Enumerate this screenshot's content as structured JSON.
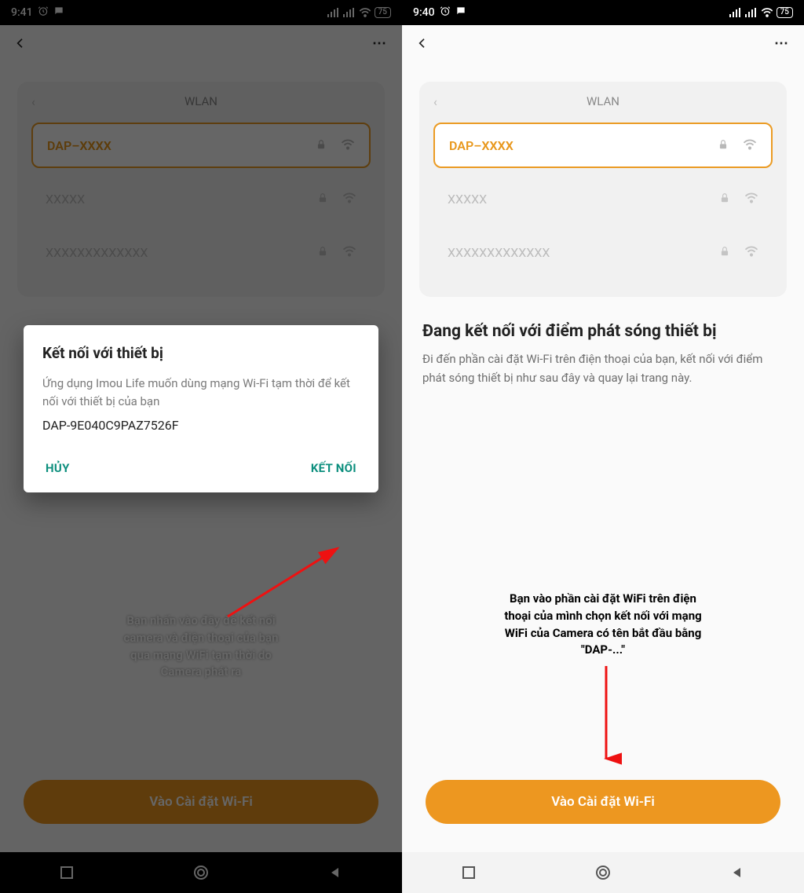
{
  "left": {
    "statusTime": "9:41",
    "battery": "75",
    "wlanTitle": "WLAN",
    "wifiItems": [
      {
        "name": "DAP–XXXX",
        "selected": true
      },
      {
        "name": "XXXXX",
        "selected": false
      },
      {
        "name": "XXXXXXXXXXXXX",
        "selected": false
      }
    ],
    "dialog": {
      "title": "Kết nối với thiết bị",
      "message": "Ứng dụng Imou Life muốn dùng mạng Wi-Fi tạm thời để kết nối với thiết bị của bạn",
      "device": "DAP-9E040C9PAZ7526F",
      "cancel": "HỦY",
      "confirm": "KẾT NỐI"
    },
    "cta": "Vào Cài đặt Wi-Fi",
    "captionLine1": "Bạn nhấn vào đây để kết nối",
    "captionLine2": "camera và điện thoại của bạn",
    "captionLine3": "qua mạng WiFi tạm thời do",
    "captionLine4": "Camera phát ra"
  },
  "right": {
    "statusTime": "9:40",
    "battery": "75",
    "wlanTitle": "WLAN",
    "wifiItems": [
      {
        "name": "DAP–XXXX",
        "selected": true
      },
      {
        "name": "XXXXX",
        "selected": false
      },
      {
        "name": "XXXXXXXXXXXXX",
        "selected": false
      }
    ],
    "sectionTitle": "Đang kết nối với điểm phát sóng thiết bị",
    "sectionDesc": "Đi đến phần cài đặt Wi-Fi trên điện thoại của bạn, kết nối với điểm phát sóng thiết bị như sau đây và quay lại trang này.",
    "cta": "Vào Cài đặt Wi-Fi",
    "captionLine1": "Bạn vào phần cài đặt WiFi trên điện",
    "captionLine2": "thoại của mình chọn kết nối với mạng",
    "captionLine3": "WiFi của Camera có tên bắt đầu bằng",
    "captionLine4": "\"DAP-...\""
  }
}
